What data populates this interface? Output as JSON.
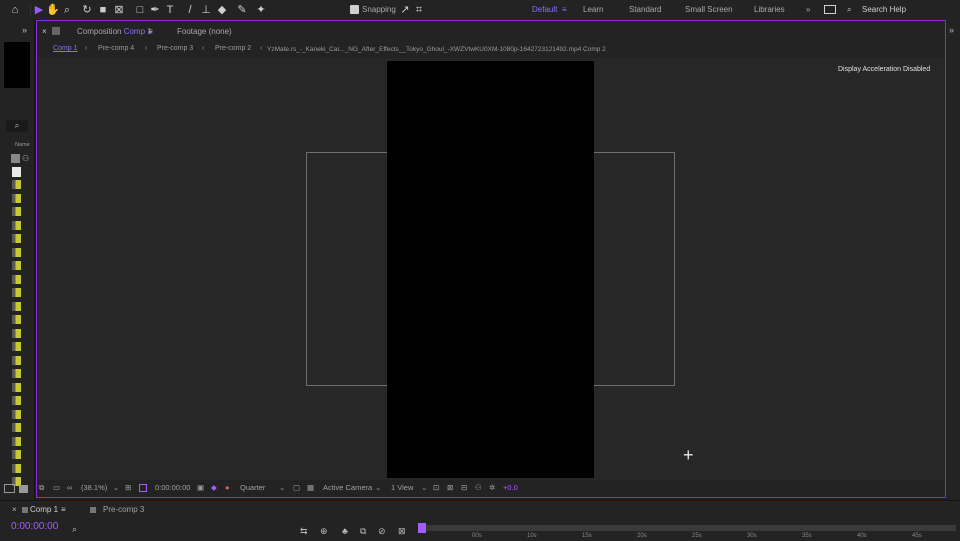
{
  "toolbar": {
    "snapping_label": "Snapping",
    "workspaces": [
      {
        "label": "Default",
        "active": true
      },
      {
        "label": "Learn",
        "active": false
      },
      {
        "label": "Standard",
        "active": false
      },
      {
        "label": "Small Screen",
        "active": false
      },
      {
        "label": "Libraries",
        "active": false
      }
    ],
    "search_placeholder": "Search Help"
  },
  "project": {
    "name_header": "Name"
  },
  "comp_panel": {
    "tab_label": "Composition",
    "tab_comp_name": "Comp 1",
    "footage_tab": "Footage (none)",
    "breadcrumbs": [
      "Comp 1",
      "Pre-comp 4",
      "Pre-comp 3",
      "Pre-comp 2",
      "YzMate.rs_-_Kaneki_Car..._NG_After_Effects__Tokyo_Ghoul_-XWZVtwKU0XM-1080p-1642723121492.mp4 Comp 2"
    ],
    "info_message": "Display Acceleration Disabled"
  },
  "viewer_bar": {
    "zoom": "(38.1%)",
    "timecode": "0:00:00:00",
    "resolution": "Quarter",
    "camera": "Active Camera",
    "views": "1 View",
    "exposure": "+0.0"
  },
  "timeline": {
    "tabs": [
      {
        "label": "Comp 1",
        "active": true
      },
      {
        "label": "Pre-comp 3",
        "active": false
      }
    ],
    "timecode": "0:00:00:00",
    "ruler_ticks": [
      "00s",
      "10s",
      "15s",
      "20s",
      "25s",
      "30s",
      "35s",
      "40s",
      "45s"
    ]
  },
  "colors": {
    "accent": "#8a2be2",
    "timecode": "#a25cff",
    "layer_label": "#c8c830"
  }
}
